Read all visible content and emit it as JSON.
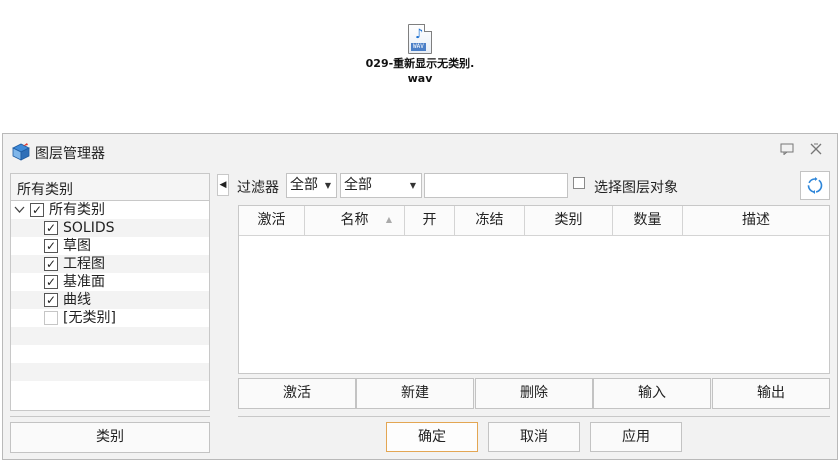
{
  "desktop_file": {
    "icon": "wav-audio-file-icon",
    "badge": "WAV",
    "name": "029-重新显示无类别.wav"
  },
  "dialog": {
    "title": "图层管理器",
    "titlebar_icons": [
      "chat-icon",
      "close-icon"
    ]
  },
  "categories": {
    "header": "所有类别",
    "tree": [
      {
        "label": "所有类别",
        "checked": true,
        "expanded": true
      },
      {
        "label": "SOLIDS",
        "checked": true
      },
      {
        "label": "草图",
        "checked": true
      },
      {
        "label": "工程图",
        "checked": true
      },
      {
        "label": "基准面",
        "checked": true
      },
      {
        "label": "曲线",
        "checked": true
      },
      {
        "label": "[无类别]",
        "checked": false
      }
    ],
    "button": "类别"
  },
  "filter": {
    "label": "过滤器",
    "combo1": "全部",
    "combo2": "全部",
    "search_value": "",
    "select_objects_label": "选择图层对象",
    "select_objects_checked": false
  },
  "grid": {
    "columns": [
      "激活",
      "名称",
      "开",
      "冻结",
      "类别",
      "数量",
      "描述"
    ],
    "sorted_column": "名称",
    "rows": []
  },
  "actions": [
    "激活",
    "新建",
    "删除",
    "输入",
    "输出"
  ],
  "footer": {
    "ok": "确定",
    "cancel": "取消",
    "apply": "应用"
  }
}
